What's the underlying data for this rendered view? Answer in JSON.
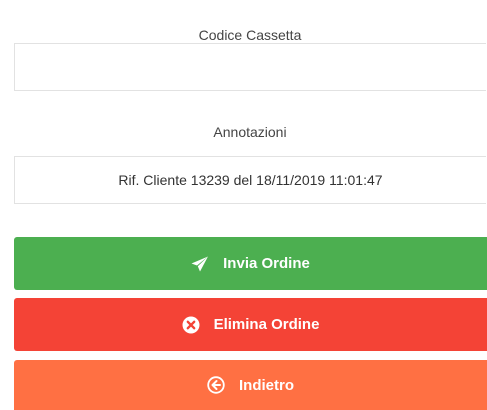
{
  "form": {
    "cassetta": {
      "label": "Codice Cassetta",
      "value": ""
    },
    "annotazioni": {
      "label": "Annotazioni",
      "value": "Rif. Cliente 13239 del 18/11/2019 11:01:47"
    }
  },
  "actions": {
    "send": {
      "label": "Invia Ordine",
      "icon": "paper-plane-icon",
      "color": "#4caf50"
    },
    "delete": {
      "label": "Elimina Ordine",
      "icon": "close-circle-icon",
      "color": "#f44336"
    },
    "back": {
      "label": "Indietro",
      "icon": "arrow-left-circle-icon",
      "color": "#ff7043"
    }
  }
}
